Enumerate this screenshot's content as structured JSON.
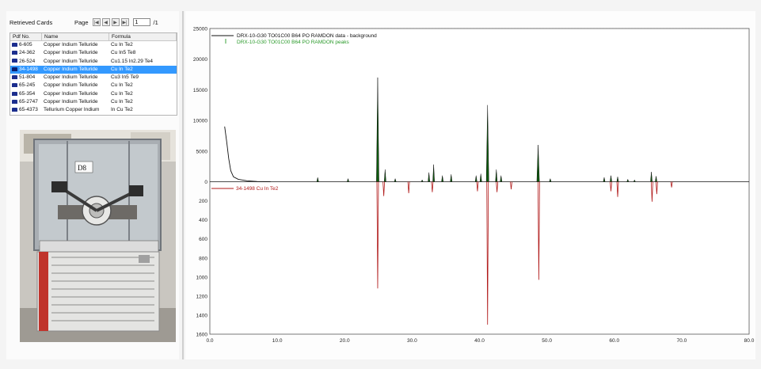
{
  "cards_panel": {
    "title": "Retrieved Cards",
    "page_label": "Page",
    "page_value": "1",
    "page_total": "/1",
    "columns": [
      "Pdf No.",
      "Name",
      "Formula"
    ],
    "rows": [
      {
        "pdf": "6-605",
        "name": "Copper Indium Telluride",
        "formula": "Cu In Te2"
      },
      {
        "pdf": "24-362",
        "name": "Copper Indium Telluride",
        "formula": "Cu In5 Te8"
      },
      {
        "pdf": "26-524",
        "name": "Copper Indium Telluride",
        "formula": "Cu1.15 In2.29 Te4"
      },
      {
        "pdf": "34-1498",
        "name": "Copper Indium Telluride",
        "formula": "Cu In Te2",
        "selected": true
      },
      {
        "pdf": "51-804",
        "name": "Copper Indium Telluride",
        "formula": "Cu3 In5 Te9"
      },
      {
        "pdf": "65-245",
        "name": "Copper Indium Telluride",
        "formula": "Cu In Te2"
      },
      {
        "pdf": "65-354",
        "name": "Copper Indium Telluride",
        "formula": "Cu In Te2"
      },
      {
        "pdf": "65-2747",
        "name": "Copper Indium Telluride",
        "formula": "Cu In Te2"
      },
      {
        "pdf": "65-4373",
        "name": "Tellurium Copper Indium",
        "formula": "In Cu Te2"
      }
    ],
    "photo_label": "D8"
  },
  "chart_data": {
    "type": "line",
    "x_ticks": [
      "0.0",
      "10.0",
      "20.0",
      "30.0",
      "40.0",
      "50.0",
      "60.0",
      "70.0",
      "80.0"
    ],
    "y_ticks_upper": [
      "25000",
      "20000",
      "15000",
      "10000",
      "5000",
      "0"
    ],
    "y_ticks_lower": [
      "200",
      "400",
      "600",
      "800",
      "1000",
      "1200",
      "1400",
      "1600"
    ],
    "xlim": [
      0,
      80
    ],
    "ylim_upper": [
      0,
      25000
    ],
    "ylim_lower": [
      0,
      1600
    ],
    "grid": true,
    "legend": [
      {
        "text": "DRX-10-G30 TO01C00 B64 PO RAMDON data - background",
        "color": "#111111"
      },
      {
        "text": "DRX-10-G30 TO01C00 B64 PO RAMDON peaks",
        "color": "#2a9a2a"
      }
    ],
    "reference_label": "34-1498 Cu In Te2",
    "reference_color": "#b01818",
    "data_color": "#111111",
    "peak_color": "#0d5a0d",
    "background_decay": [
      [
        2.2,
        9000
      ],
      [
        2.5,
        6500
      ],
      [
        2.8,
        3800
      ],
      [
        3.1,
        1800
      ],
      [
        3.5,
        800
      ],
      [
        4.2,
        400
      ],
      [
        5.5,
        150
      ],
      [
        7,
        40
      ],
      [
        9,
        0
      ]
    ],
    "measured_peaks": [
      [
        16,
        700
      ],
      [
        20.5,
        500
      ],
      [
        24.9,
        17000
      ],
      [
        26.0,
        2000
      ],
      [
        27.5,
        500
      ],
      [
        31.5,
        300
      ],
      [
        32.5,
        1500
      ],
      [
        33.2,
        2800
      ],
      [
        34.5,
        1000
      ],
      [
        35.8,
        1200
      ],
      [
        39.5,
        1000
      ],
      [
        40.2,
        1300
      ],
      [
        41.2,
        12500
      ],
      [
        42.5,
        2000
      ],
      [
        43.2,
        1000
      ],
      [
        48.7,
        6000
      ],
      [
        50.5,
        500
      ],
      [
        58.5,
        700
      ],
      [
        59.5,
        1000
      ],
      [
        60.5,
        800
      ],
      [
        62.0,
        400
      ],
      [
        63.0,
        300
      ],
      [
        65.5,
        1600
      ],
      [
        66.2,
        900
      ]
    ],
    "reference_peaks": [
      [
        24.9,
        1120
      ],
      [
        25.8,
        150
      ],
      [
        29.5,
        120
      ],
      [
        33.0,
        110
      ],
      [
        39.7,
        100
      ],
      [
        41.2,
        1500
      ],
      [
        42.6,
        110
      ],
      [
        44.7,
        80
      ],
      [
        48.8,
        1030
      ],
      [
        59.5,
        100
      ],
      [
        60.5,
        160
      ],
      [
        65.6,
        210
      ],
      [
        66.3,
        130
      ],
      [
        68.5,
        60
      ]
    ]
  }
}
